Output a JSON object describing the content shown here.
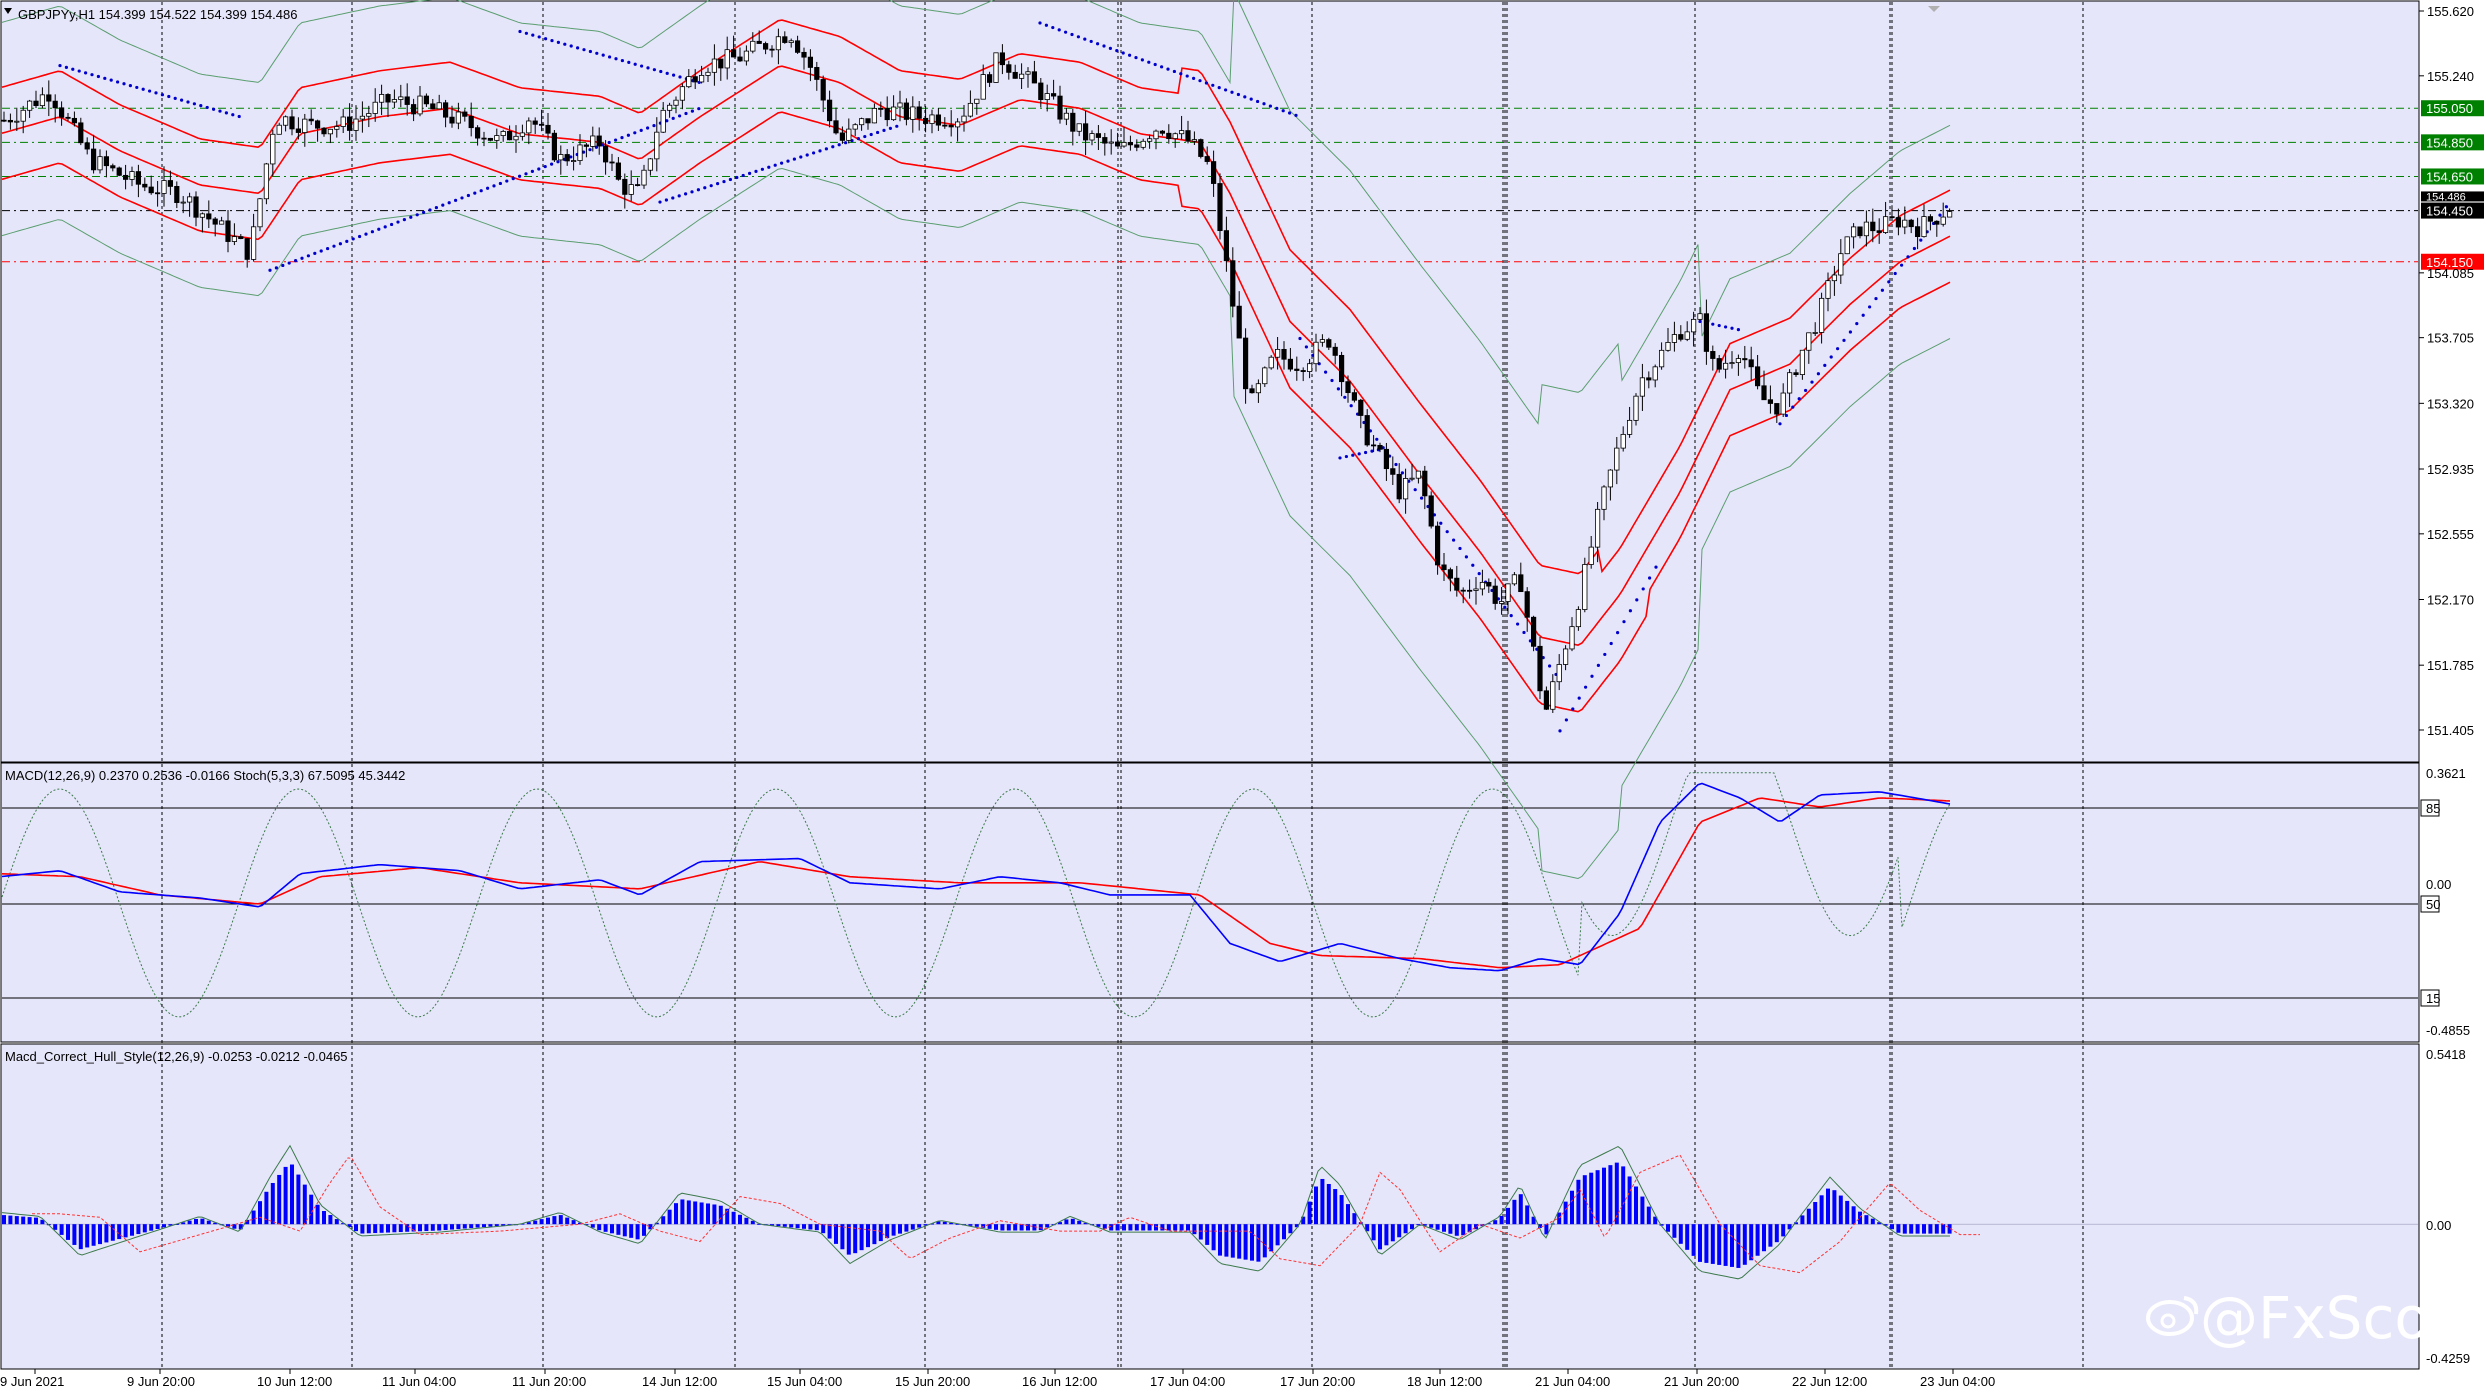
{
  "colors": {
    "background": "#e6e6fa",
    "grid": "#000000",
    "bull_candle": "#ffffff",
    "bear_candle": "#000000",
    "envelope": "#ff0000",
    "bollinger": "#5a9e6f",
    "sar": "#0000cc",
    "macd_main": "#0000ff",
    "macd_signal": "#ff0000",
    "histogram": "#0000ff",
    "level_green": "#008000",
    "level_red": "#ff0000"
  },
  "main_panel": {
    "header": "GBPJPYy,H1  154.399 154.522 154.399 154.486",
    "price_ticks": [
      "155.620",
      "155.240",
      "154.085",
      "153.705",
      "153.320",
      "152.935",
      "152.555",
      "152.170",
      "151.785",
      "151.405"
    ],
    "levels": [
      {
        "value": 155.05,
        "label": "155.050",
        "color": "#008000"
      },
      {
        "value": 154.85,
        "label": "154.850",
        "color": "#008000"
      },
      {
        "value": 154.65,
        "label": "154.650",
        "color": "#008000"
      },
      {
        "value": 154.45,
        "label": "154.450",
        "color": "#000000"
      },
      {
        "value": 154.15,
        "label": "154.150",
        "color": "#ff0000"
      }
    ],
    "current_price_label": "154.486"
  },
  "macd_panel": {
    "header": "MACD(12,26,9) 0.2370 0.2536 -0.0166  Stoch(5,3,3) 67.5095 45.3442",
    "ticks": [
      "0.3621",
      "85",
      "0.00",
      "50",
      "15",
      "-0.4855"
    ]
  },
  "hull_panel": {
    "header": "Macd_Correct_Hull_Style(12,26,9) -0.0253 -0.0212 -0.0465",
    "ticks": [
      "0.5418",
      "0.00",
      "-0.4259"
    ]
  },
  "time_axis": [
    "9 Jun 2021",
    "9 Jun 20:00",
    "10 Jun 12:00",
    "11 Jun 04:00",
    "11 Jun 20:00",
    "14 Jun 12:00",
    "15 Jun 04:00",
    "15 Jun 20:00",
    "16 Jun 12:00",
    "17 Jun 04:00",
    "17 Jun 20:00",
    "18 Jun 12:00",
    "21 Jun 04:00",
    "21 Jun 20:00",
    "22 Jun 12:00",
    "23 Jun 04:00"
  ],
  "watermark": "@FxScotty"
}
